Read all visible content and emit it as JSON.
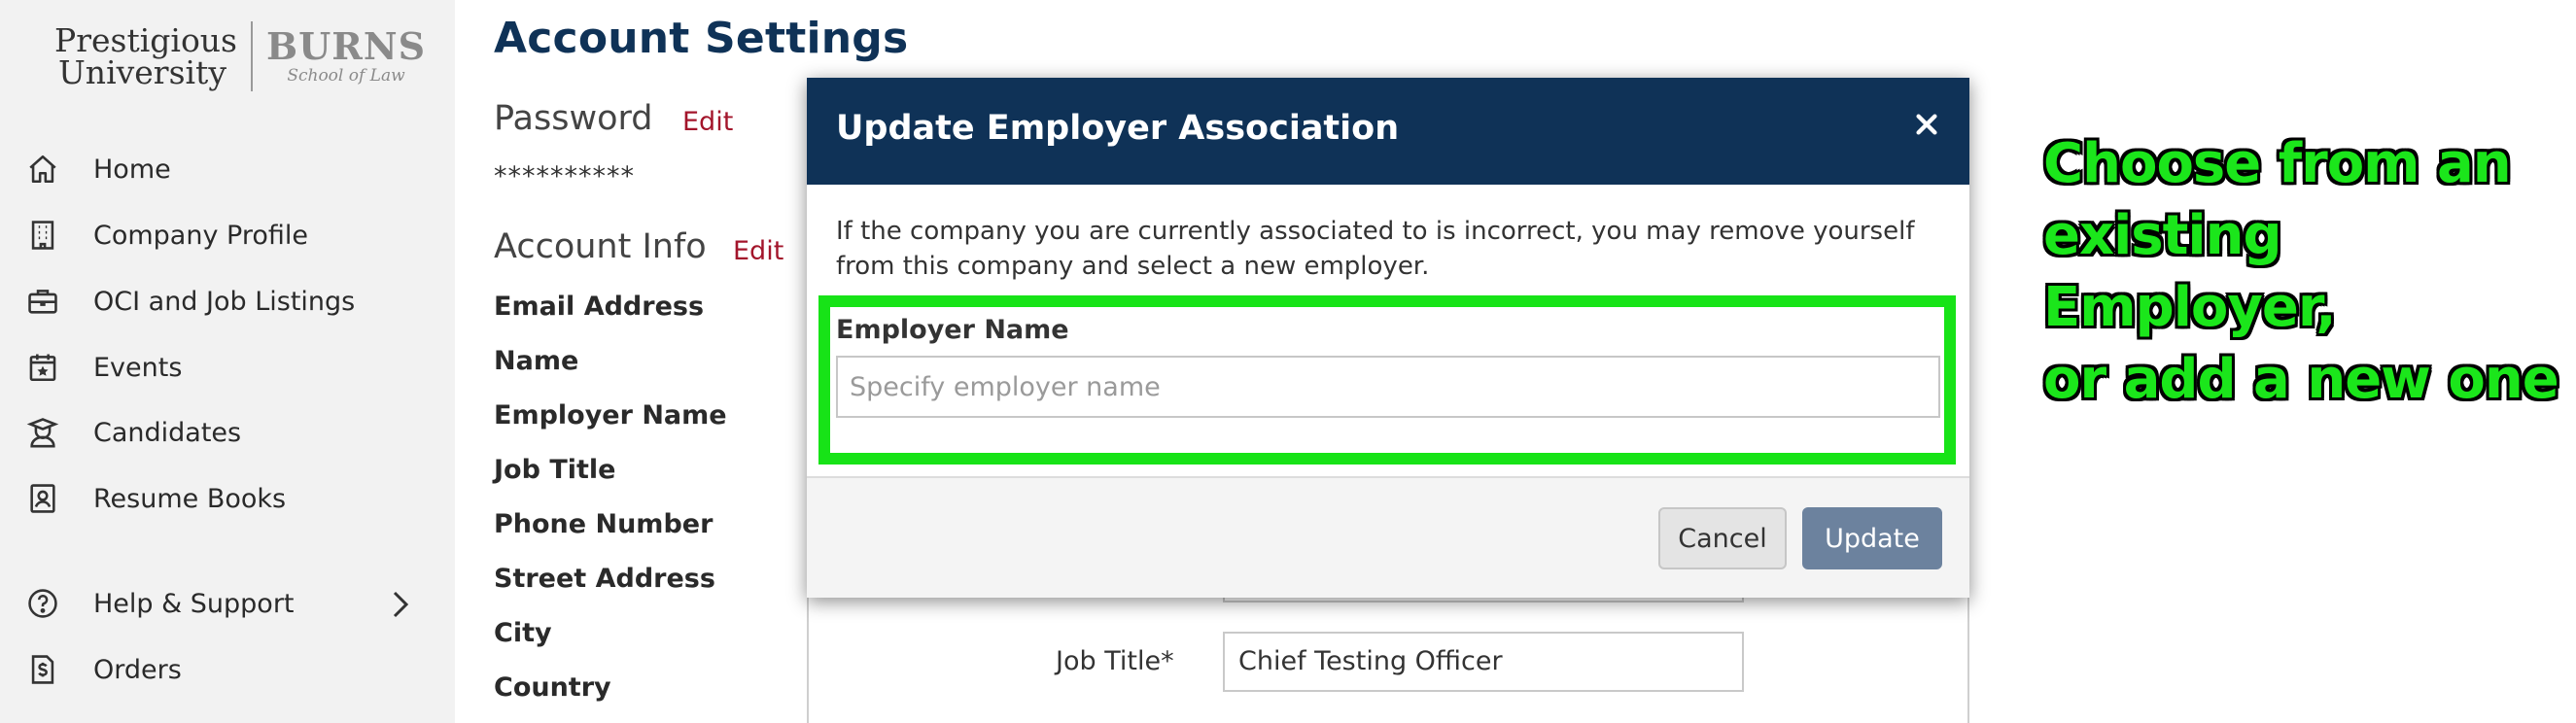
{
  "sidebar": {
    "logo": {
      "line1": "Prestigious",
      "line2": "University",
      "brand": "BURNS",
      "subtitle": "School of Law"
    },
    "items": [
      {
        "label": "Home",
        "icon": "home-icon"
      },
      {
        "label": "Company Profile",
        "icon": "building-icon"
      },
      {
        "label": "OCI and Job Listings",
        "icon": "briefcase-icon"
      },
      {
        "label": "Events",
        "icon": "calendar-star-icon"
      },
      {
        "label": "Candidates",
        "icon": "graduate-icon"
      },
      {
        "label": "Resume Books",
        "icon": "id-badge-icon"
      },
      {
        "label": "Help & Support",
        "icon": "question-circle-icon"
      },
      {
        "label": "Orders",
        "icon": "receipt-dollar-icon"
      }
    ]
  },
  "main": {
    "title": "Account Settings",
    "password": {
      "heading": "Password",
      "edit": "Edit",
      "masked": "**********"
    },
    "account_info": {
      "heading": "Account Info",
      "edit": "Edit",
      "fields": [
        "Email Address",
        "Name",
        "Employer Name",
        "Job Title",
        "Phone Number",
        "Street Address",
        "City",
        "Country"
      ]
    },
    "background_form": {
      "job_title_label": "Job Title*",
      "job_title_value": "Chief Testing Officer"
    }
  },
  "modal": {
    "title": "Update Employer Association",
    "description": "If the company you are currently associated to is incorrect, you may remove yourself from this company and select a new employer.",
    "field_label": "Employer Name",
    "placeholder": "Specify employer name",
    "cancel_label": "Cancel",
    "update_label": "Update"
  },
  "callout": {
    "line1": "Choose from an",
    "line2": "existing Employer,",
    "line3": "or add a new one"
  },
  "colors": {
    "brand_navy": "#0f3257",
    "edit_red": "#a3152b",
    "highlight_green": "#17e317",
    "update_button": "#6c829e"
  }
}
